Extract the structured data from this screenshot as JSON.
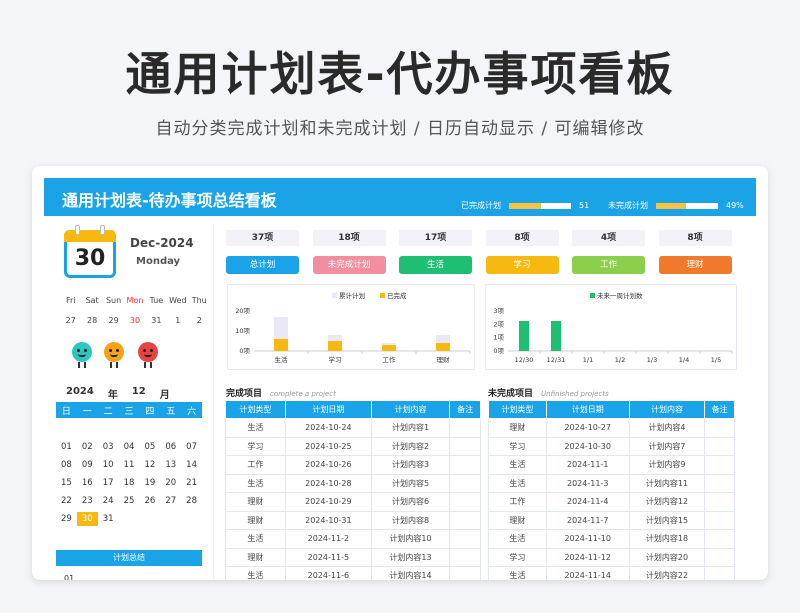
{
  "hero": {
    "title": "通用计划表-代办事项看板",
    "subtitle": "自动分类完成计划和未完成计划  /  日历自动显示  /  可编辑修改"
  },
  "header": {
    "title": "通用计划表-待办事项总结看板",
    "done": {
      "label": "已完成计划",
      "value": "51",
      "fraction": 0.51
    },
    "todo": {
      "label": "未完成计划",
      "value": "49%",
      "fraction": 0.49
    },
    "accent": "#1aa3e6"
  },
  "calendar": {
    "day": "30",
    "month_year": "Dec-2024",
    "weekday": "Monday",
    "week_header": [
      "Fri",
      "Sat",
      "Sun",
      "Mon",
      "Tue",
      "Wed",
      "Thu"
    ],
    "week_days": [
      "27",
      "28",
      "29",
      "30",
      "31",
      "1",
      "2"
    ],
    "year": "2024",
    "year_label": "年",
    "month": "12",
    "month_label": "月",
    "dow": [
      "日",
      "一",
      "二",
      "三",
      "四",
      "五",
      "六"
    ],
    "rows": [
      [
        "",
        "",
        "",
        "",
        "",
        "",
        ""
      ],
      [
        "01",
        "02",
        "03",
        "04",
        "05",
        "06",
        "07"
      ],
      [
        "08",
        "09",
        "10",
        "11",
        "12",
        "13",
        "14"
      ],
      [
        "15",
        "16",
        "17",
        "18",
        "19",
        "20",
        "21"
      ],
      [
        "22",
        "23",
        "24",
        "25",
        "26",
        "27",
        "28"
      ],
      [
        "29",
        "30",
        "31",
        "",
        "",
        "",
        ""
      ]
    ],
    "summary_title": "计划总结",
    "summary_first": "01"
  },
  "stats": [
    {
      "value": "37项",
      "label": "总计划",
      "color": "#1aa3e6"
    },
    {
      "value": "18项",
      "label": "未完成计划",
      "color": "#f18ea0"
    },
    {
      "value": "17项",
      "label": "生活",
      "color": "#1fbf73"
    },
    {
      "value": "8项",
      "label": "学习",
      "color": "#f5b90f"
    },
    {
      "value": "4项",
      "label": "工作",
      "color": "#8ccf4d"
    },
    {
      "value": "8项",
      "label": "理财",
      "color": "#f07a2a"
    }
  ],
  "chart_data": [
    {
      "type": "bar",
      "categories": [
        "生活",
        "学习",
        "工作",
        "理财"
      ],
      "series": [
        {
          "name": "累计计划",
          "values": [
            17,
            8,
            4,
            8
          ],
          "color": "#ebe8f6"
        },
        {
          "name": "已完成",
          "values": [
            6,
            5,
            3,
            4
          ],
          "color": "#f5b90f"
        }
      ],
      "ylim": [
        0,
        20
      ],
      "yticks": [
        "0项",
        "10项",
        "20项"
      ],
      "legend": "top"
    },
    {
      "type": "bar",
      "categories": [
        "12/30",
        "12/31",
        "1/1",
        "1/2",
        "1/3",
        "1/4",
        "1/5"
      ],
      "series": [
        {
          "name": "未来一周计划数",
          "values": [
            3,
            3,
            0,
            0,
            0,
            0,
            0
          ],
          "color": "#1fbf73"
        }
      ],
      "ylim": [
        0,
        4
      ],
      "yticks": [
        "0项",
        "1项",
        "2项",
        "3项"
      ],
      "legend": "top"
    }
  ],
  "completed": {
    "title": "完成项目",
    "subtitle": "complete a project",
    "headers": [
      "计划类型",
      "计划日期",
      "计划内容",
      "备注"
    ],
    "rows": [
      [
        "生活",
        "2024-10-24",
        "计划内容1",
        ""
      ],
      [
        "学习",
        "2024-10-25",
        "计划内容2",
        ""
      ],
      [
        "工作",
        "2024-10-26",
        "计划内容3",
        ""
      ],
      [
        "生活",
        "2024-10-28",
        "计划内容5",
        ""
      ],
      [
        "理财",
        "2024-10-29",
        "计划内容6",
        ""
      ],
      [
        "理财",
        "2024-10-31",
        "计划内容8",
        ""
      ],
      [
        "生活",
        "2024-11-2",
        "计划内容10",
        ""
      ],
      [
        "理财",
        "2024-11-5",
        "计划内容13",
        ""
      ],
      [
        "生活",
        "2024-11-6",
        "计划内容14",
        ""
      ]
    ]
  },
  "unfinished": {
    "title": "未完成项目",
    "subtitle": "Unfinished projects",
    "headers": [
      "计划类型",
      "计划日期",
      "计划内容",
      "备注"
    ],
    "rows": [
      [
        "理财",
        "2024-10-27",
        "计划内容4",
        ""
      ],
      [
        "学习",
        "2024-10-30",
        "计划内容7",
        ""
      ],
      [
        "生活",
        "2024-11-1",
        "计划内容9",
        ""
      ],
      [
        "生活",
        "2024-11-3",
        "计划内容11",
        ""
      ],
      [
        "工作",
        "2024-11-4",
        "计划内容12",
        ""
      ],
      [
        "理财",
        "2024-11-7",
        "计划内容15",
        ""
      ],
      [
        "生活",
        "2024-11-10",
        "计划内容18",
        ""
      ],
      [
        "学习",
        "2024-11-12",
        "计划内容20",
        ""
      ],
      [
        "生活",
        "2024-11-14",
        "计划内容22",
        ""
      ]
    ]
  }
}
